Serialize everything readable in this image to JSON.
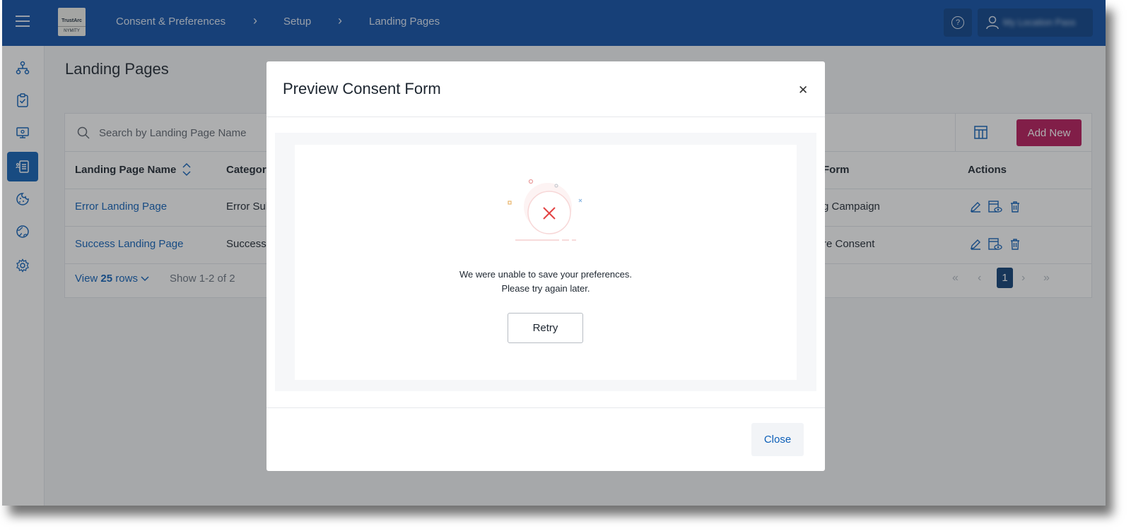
{
  "header": {
    "breadcrumbs": [
      "Consent & Preferences",
      "Setup",
      "Landing Pages"
    ],
    "logo_line1": "TrustArc",
    "logo_line2": "NYMITY",
    "user_name": "My Location Pass"
  },
  "page": {
    "title": "Landing Pages",
    "search_placeholder": "Search by Landing Page Name",
    "add_new_label": "Add New"
  },
  "table": {
    "columns": [
      "Landing Page Name",
      "Category",
      "Form",
      "Actions"
    ],
    "rows": [
      {
        "name": "Error Landing Page",
        "category": "Error Sub",
        "form": "g Campaign"
      },
      {
        "name": "Success Landing Page",
        "category": "Success",
        "form": "re Consent"
      }
    ],
    "view_rows_prefix": "View ",
    "view_rows_count": "25",
    "view_rows_suffix": " rows",
    "show_count": "Show 1-2 of 2",
    "current_page": "1"
  },
  "modal": {
    "title": "Preview Consent Form",
    "error_line1": "We were unable to save your preferences.",
    "error_line2": "Please try again later.",
    "retry_label": "Retry",
    "close_label": "Close"
  },
  "colors": {
    "topbar": "#0d4ea6",
    "accent": "#b8185a",
    "link": "#0d5fb8",
    "error": "#e34242"
  }
}
